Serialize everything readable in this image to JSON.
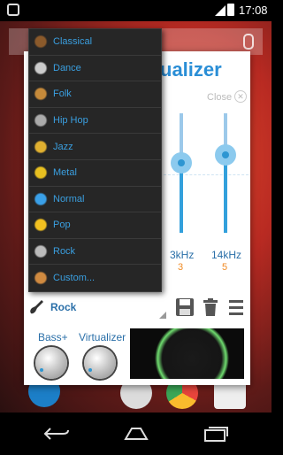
{
  "status_bar": {
    "time": "17:08"
  },
  "app": {
    "title": "ualizer",
    "close_label": "Close",
    "close_icon": "close-circle-icon",
    "bands": [
      {
        "freq": "3kHz",
        "level": "3",
        "fraction": 0.55
      },
      {
        "freq": "14kHz",
        "level": "5",
        "fraction": 0.62
      }
    ],
    "preset": {
      "label": "Rock",
      "icon": "guitar-icon"
    },
    "toolbar": {
      "save_icon": "save-icon",
      "delete_icon": "trash-icon",
      "menu_icon": "menu-icon"
    },
    "effects": [
      {
        "label": "Bass+",
        "icon": "knob-icon"
      },
      {
        "label": "Virtualizer",
        "icon": "knob-icon"
      }
    ]
  },
  "dropdown": {
    "items": [
      {
        "label": "Classical",
        "icon": "violin-icon"
      },
      {
        "label": "Dance",
        "icon": "turntable-icon"
      },
      {
        "label": "Folk",
        "icon": "acoustic-guitar-icon"
      },
      {
        "label": "Hip Hop",
        "icon": "microphone-icon"
      },
      {
        "label": "Jazz",
        "icon": "saxophone-icon"
      },
      {
        "label": "Metal",
        "icon": "metal-emblem-icon"
      },
      {
        "label": "Normal",
        "icon": "music-note-icon"
      },
      {
        "label": "Pop",
        "icon": "smiley-icon"
      },
      {
        "label": "Rock",
        "icon": "electric-guitar-icon"
      },
      {
        "label": "Custom...",
        "icon": "person-icon"
      }
    ]
  },
  "colors": {
    "accent": "#2a8ed6",
    "level": "#f08a24",
    "dropdown_bg": "#262626"
  }
}
